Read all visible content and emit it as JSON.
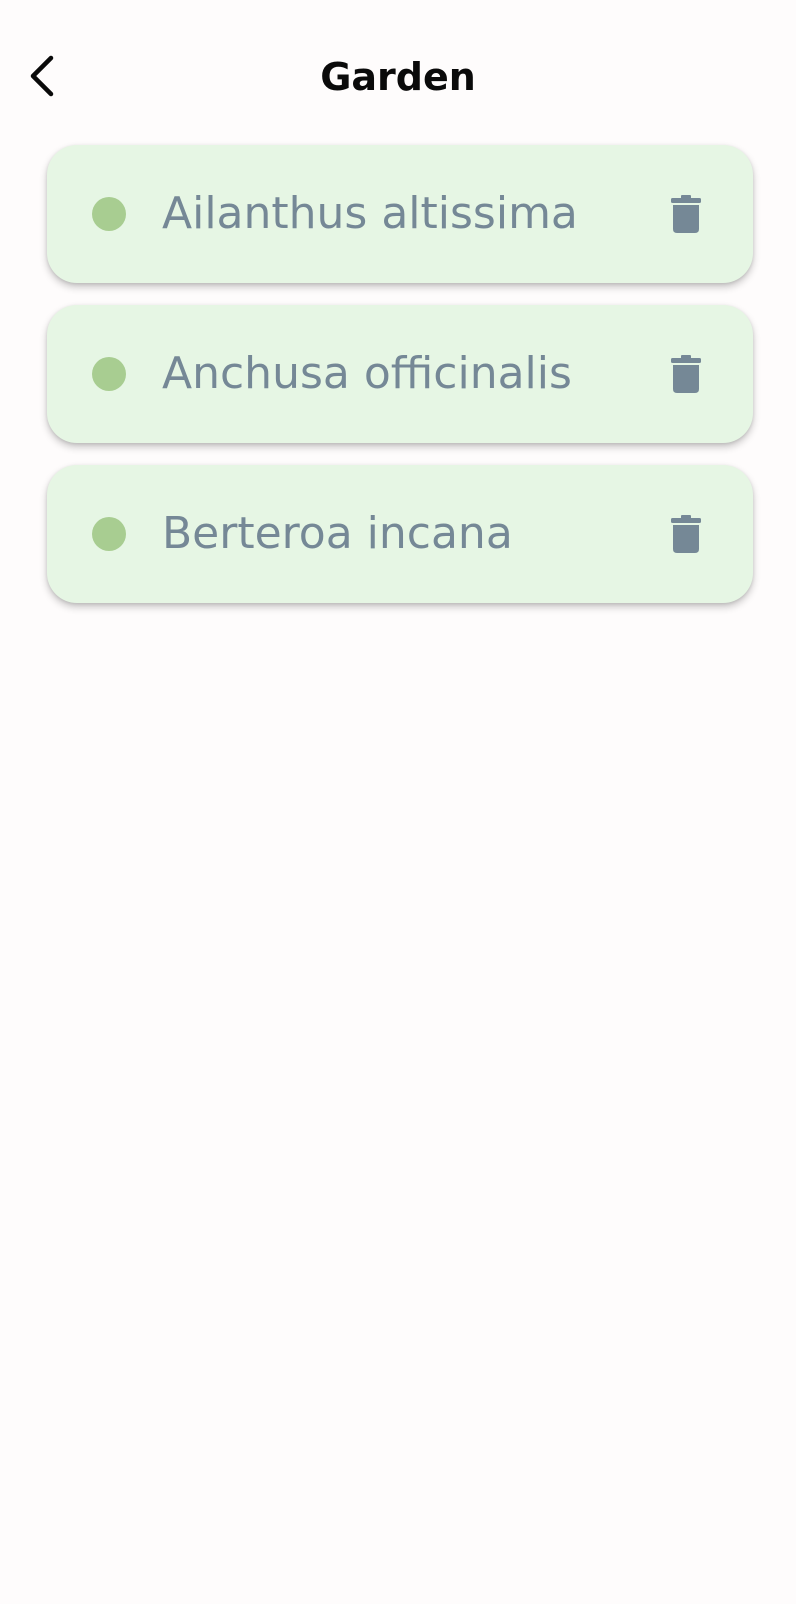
{
  "header": {
    "title": "Garden",
    "back_icon": "chevron-left-icon"
  },
  "plants": [
    {
      "name": "Ailanthus altissima",
      "status_color": "#a8cd91",
      "action_icon": "trash-icon"
    },
    {
      "name": "Anchusa officinalis",
      "status_color": "#a8cd91",
      "action_icon": "trash-icon"
    },
    {
      "name": "Berteroa incana",
      "status_color": "#a8cd91",
      "action_icon": "trash-icon"
    }
  ],
  "colors": {
    "background": "#fefcfc",
    "card_background": "#e6f6e4",
    "text_secondary": "#758896",
    "title": "#0a0a0a"
  }
}
